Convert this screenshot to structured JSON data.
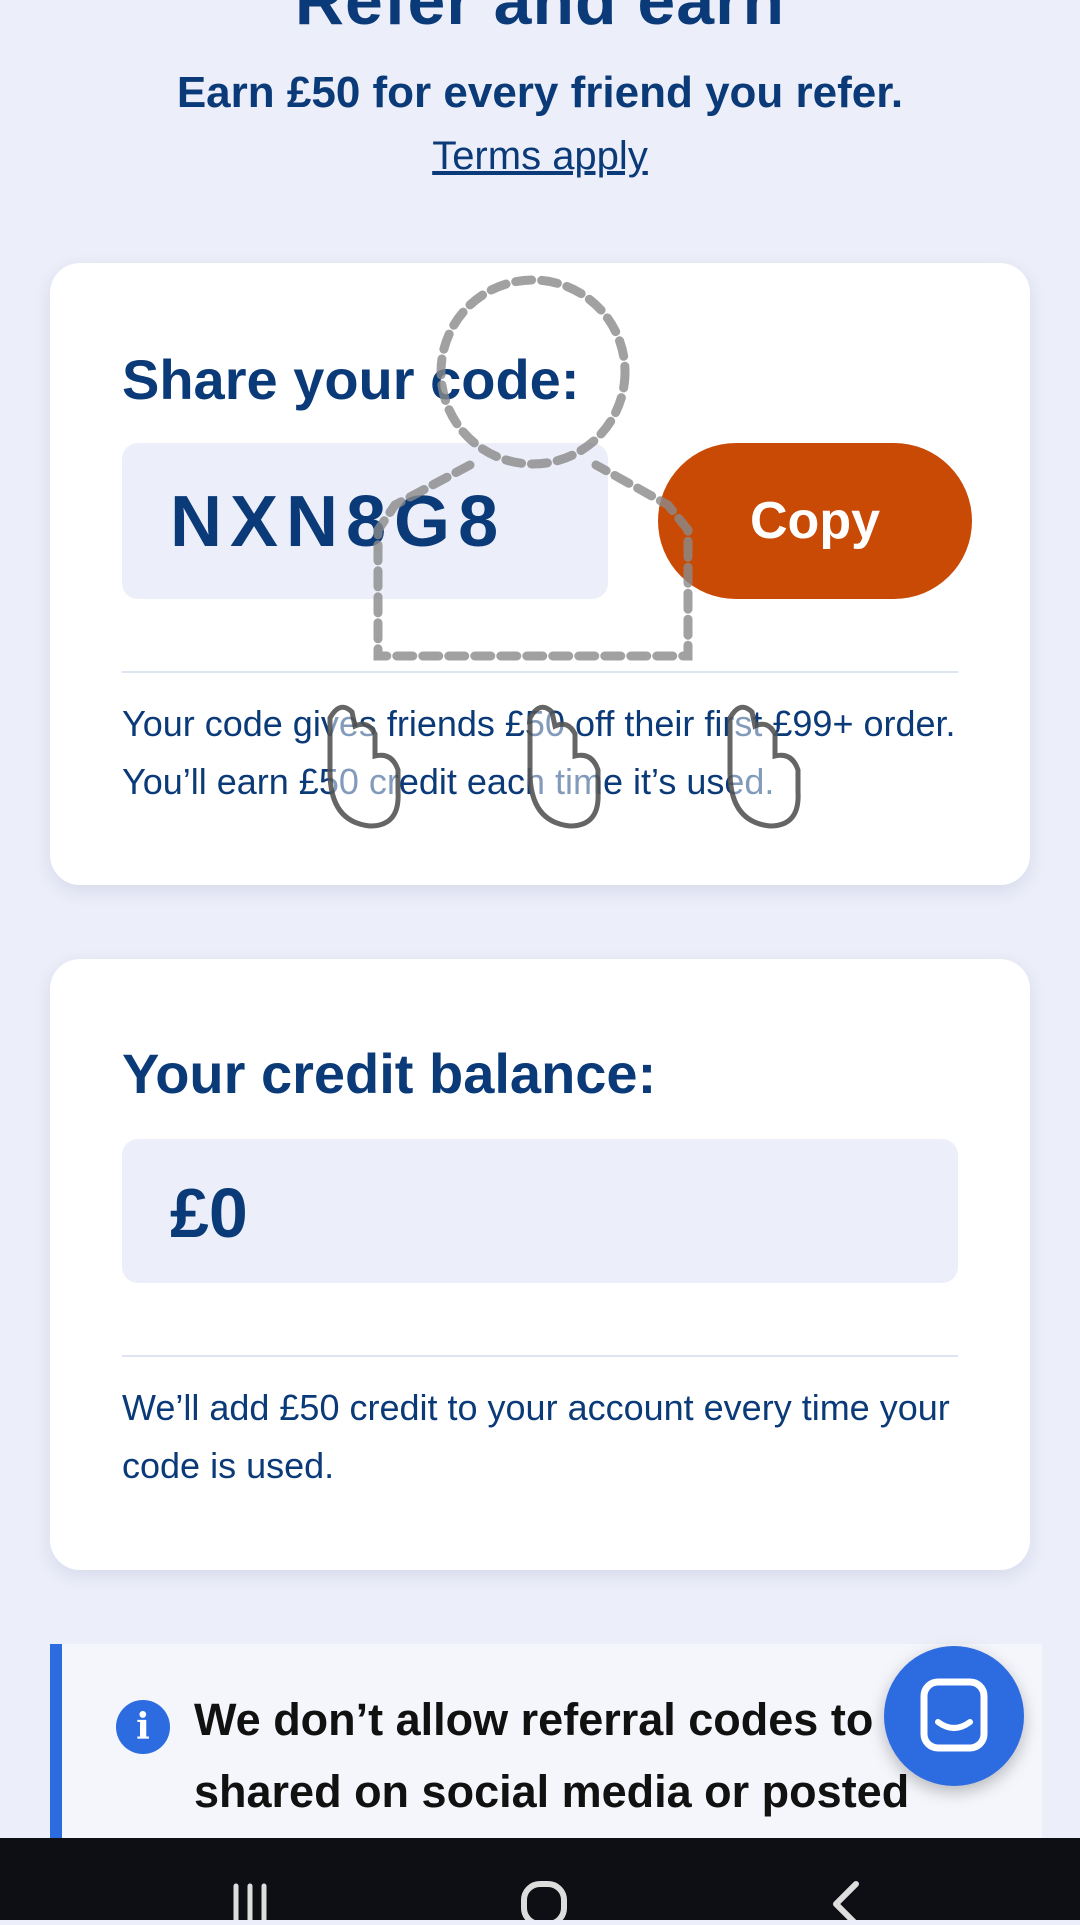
{
  "header": {
    "title": "Refer and earn",
    "subtitle": "Earn £50 for every friend you refer.",
    "terms_link": "Terms apply"
  },
  "share_card": {
    "heading": "Share your code:",
    "code": "NXN8G8",
    "copy_label": "Copy",
    "description": "Your code gives friends £50 off their first £99+ order. You’ll earn £50 credit each time it’s used."
  },
  "credit_card": {
    "heading": "Your credit balance:",
    "balance": "£0",
    "description": "We’ll add £50 credit to your account every time your code is used."
  },
  "notice": {
    "icon": "info-icon",
    "text": "We don’t allow referral codes to be shared on social media or posted"
  },
  "chat_button": {
    "icon": "chat-bubble-icon"
  },
  "nav_bar": {
    "recents_icon": "recents-icon",
    "home_icon": "home-icon",
    "back_icon": "back-icon"
  },
  "overlay": {
    "icon": "tap-gesture-hint-icon"
  },
  "colors": {
    "background": "#ECEEF9",
    "brand_navy": "#0B3A78",
    "copy_button": "#C94A05",
    "accent_blue": "#2D6BE0"
  }
}
